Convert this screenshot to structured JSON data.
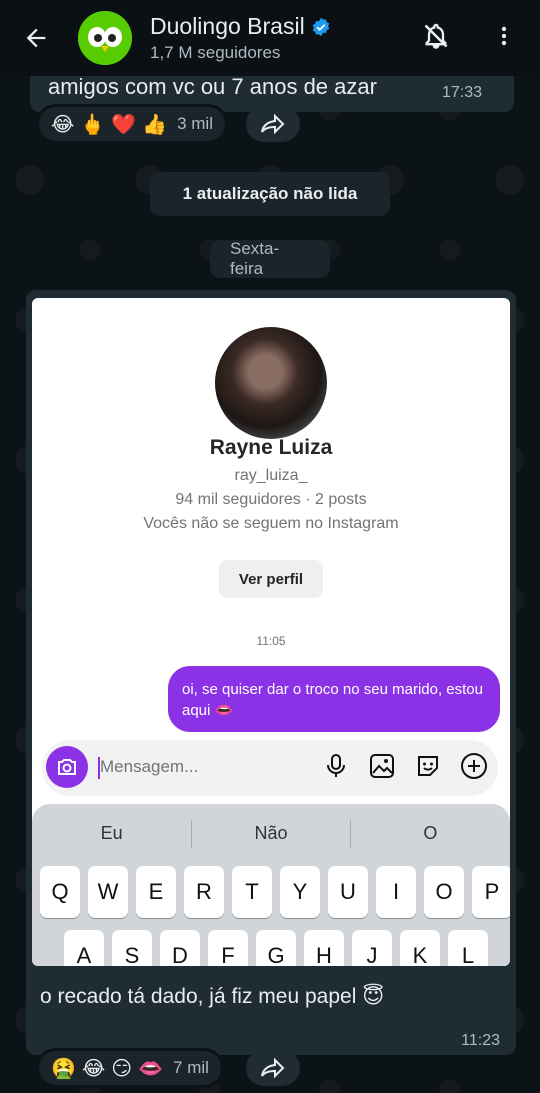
{
  "header": {
    "title": "Duolingo Brasil",
    "subtitle": "1,7 M seguidores"
  },
  "messages": [
    {
      "text": "amigos com vc ou 7 anos de azar",
      "time": "17:33",
      "reactions": [
        "😂",
        "🖕",
        "❤️",
        "👍"
      ],
      "reaction_count": "3 mil"
    }
  ],
  "divider": {
    "unread": "1 atualização não lida",
    "day": "Sexta-feira"
  },
  "screenshot": {
    "profile_name": "Rayne Luiza",
    "username": "ray_luiza_",
    "stats": "94 mil seguidores · 2 posts",
    "follow_status": "Vocês não se seguem no Instagram",
    "view_profile": "Ver perfil",
    "time": "11:05",
    "outgoing_message": "oi, se quiser dar o troco no seu marido, estou aqui 👄",
    "input_placeholder": "Mensagem...",
    "suggestions": [
      "Eu",
      "Não",
      "O"
    ],
    "keys_row1": [
      "Q",
      "W",
      "E",
      "R",
      "T",
      "Y",
      "U",
      "I",
      "O",
      "P"
    ],
    "keys_row2": [
      "A",
      "S",
      "D",
      "F",
      "G",
      "H",
      "J",
      "K",
      "L"
    ]
  },
  "caption": {
    "text": "o recado tá dado, já fiz meu papel 😇",
    "time": "11:23",
    "reactions": [
      "🤮",
      "😂",
      "😏",
      "👄"
    ],
    "reaction_count": "7 mil"
  },
  "colors": {
    "accent": "#8b31e6",
    "verified": "#1d9bf0",
    "duo_green": "#58cc02"
  }
}
